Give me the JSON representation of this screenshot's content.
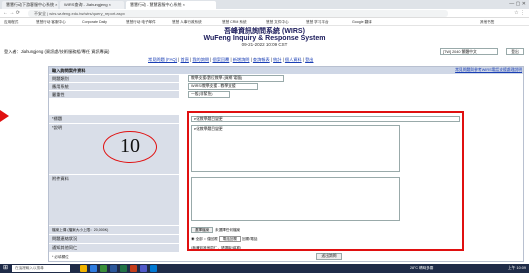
{
  "browser": {
    "tabs": [
      {
        "label": "慧慧行动下游客服中心系统 ×"
      },
      {
        "label": "WIRS查询 - Jiahungjeng ×"
      },
      {
        "label": "慧慧行动 - 慧慧客服中心系统 ×"
      }
    ],
    "url": "不安全 | wirs.wufeng.edu.tw/wirs/query_report.aspx",
    "bookmarks": [
      "应用程式",
      "慧慧行动 客服中心",
      "Corporate Daily",
      "慧慧行动 电子邮件",
      "慧慧 人事行政系统",
      "慧慧 CRM 系统",
      "慧慧 文件中心",
      "慧慧 学习平台",
      "Google 翻译",
      "其他书签"
    ]
  },
  "header": {
    "title_cn": "吾峰資訊詢問系統 (WIRS)",
    "title_en": "WuFeng Inquiry & Response System",
    "datetime": "09-21-2022 10:09 CST",
    "user_line": "登入者：Jiahungjeng (資訊處/技術服務組/專任 資訊專員)",
    "lang_select": "[TW] 2040 繁體中文",
    "top_right": "登出"
  },
  "nav": {
    "items": [
      "常見問題 (FAQ)",
      "首頁",
      "我的詢問",
      "個案回覆",
      "新增詢問",
      "查詢報表",
      "統計",
      "個人資料",
      "登出"
    ]
  },
  "form": {
    "section_title": "輸入詢問案件資料",
    "help_link": "常見問題與參考WIRS電話支援處理說明",
    "fields": {
      "category_label": "問題類別",
      "category_value": "教學支援/數位教學 (資網 電腦)",
      "app_label": "應用系統",
      "app_value": "WIRS/教學支援 - 教學支援",
      "priority_label": "嚴重性",
      "priority_value": "一般(非緊急)",
      "subject_label": "*標題",
      "subject_value": "e化教學題目變更",
      "desc_label": "*說明",
      "desc_value": "e化教學題目變更",
      "attach_label": "附件資料",
      "upload_label": "檔案上傳 (檔案大小上限：20,000K)",
      "choose_btn": "選擇檔案",
      "no_file": "未選擇任何檔案",
      "contact_label": "問題連絡狀況",
      "contact_opt1": "全部",
      "contact_opt2": "僅回覆",
      "contact_opt3": "電話回覆",
      "contact_suffix": "回覆/電話",
      "cc_label": "通知其他同仁",
      "cc_value": "(無通知其他同仁，請選取/填寫)",
      "required_note": "* 必填欄位",
      "submit_btn": "送出詢問"
    }
  },
  "annotation": {
    "number": "10",
    "accent": "#e01010"
  },
  "taskbar": {
    "search_placeholder": "在這裡輸入以搜尋",
    "weather": "28°C 晴時多雲",
    "clock": "上午 10:09"
  }
}
